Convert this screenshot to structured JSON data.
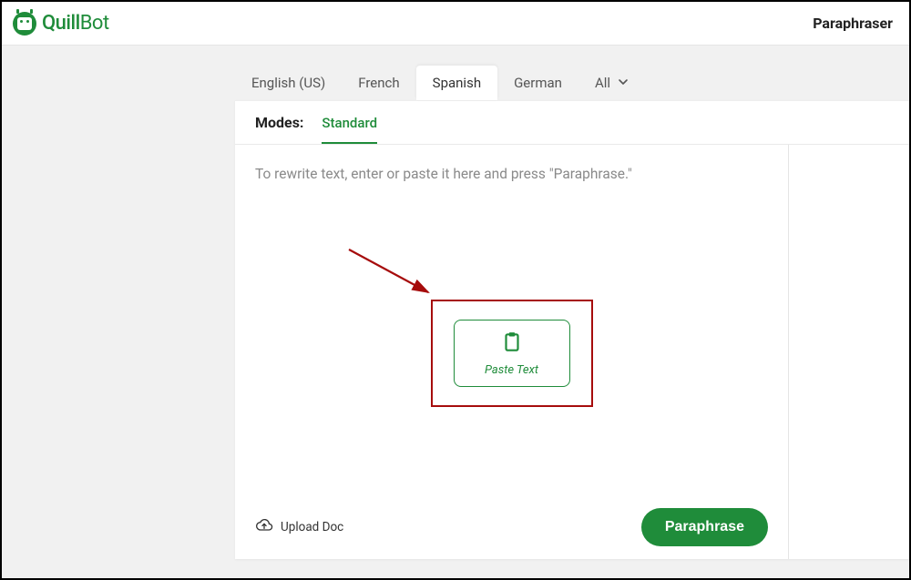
{
  "header": {
    "logo_quill": "Quill",
    "logo_bot": "Bot",
    "page_title": "Paraphraser"
  },
  "languages": {
    "items": [
      {
        "label": "English (US)",
        "active": false
      },
      {
        "label": "French",
        "active": false
      },
      {
        "label": "Spanish",
        "active": true
      },
      {
        "label": "German",
        "active": false
      },
      {
        "label": "All",
        "active": false,
        "dropdown": true
      }
    ]
  },
  "modes": {
    "label": "Modes:",
    "items": [
      {
        "label": "Standard",
        "active": true
      }
    ]
  },
  "editor": {
    "placeholder": "To rewrite text, enter or paste it here and press \"Paraphrase.\"",
    "paste_button_label": "Paste Text",
    "upload_doc_label": "Upload Doc",
    "paraphrase_button_label": "Paraphrase"
  },
  "colors": {
    "brand_green": "#1f8c3a",
    "annotation_red": "#a60c0c"
  }
}
